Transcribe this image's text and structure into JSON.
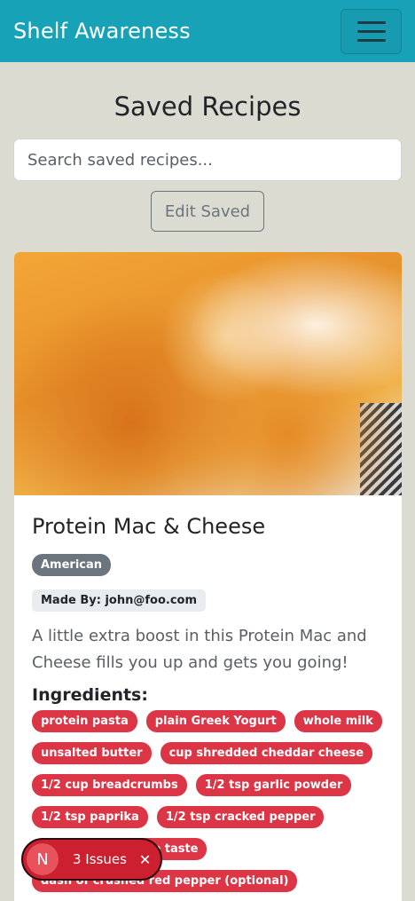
{
  "navbar": {
    "brand": "Shelf Awareness",
    "toggle_icon": "hamburger-icon"
  },
  "main": {
    "title": "Saved Recipes",
    "search_placeholder": "Search saved recipes...",
    "edit_label": "Edit Saved"
  },
  "recipe": {
    "title": "Protein Mac & Cheese",
    "cuisine": "American",
    "made_by": "Made By: john@foo.com",
    "description": "A little extra boost in this Protein Mac and Cheese fills you up and gets you going!",
    "ingredients_heading": "Ingredients:",
    "ingredients": [
      "protein pasta",
      "plain Greek Yogurt",
      "whole milk",
      "unsalted butter",
      "cup shredded cheddar cheese",
      "1/2 cup breadcrumbs",
      "1/2 tsp garlic powder",
      "1/2 tsp paprika",
      "1/2 tsp cracked pepper",
      "salt and pepper to taste",
      "dash of crushed red pepper (optional)"
    ]
  },
  "issues_badge": {
    "avatar": "N",
    "label": "3 Issues",
    "close_icon": "close-icon"
  },
  "colors": {
    "navbar": "#17a2b8",
    "danger": "#dc3545",
    "secondary": "#6c757d"
  }
}
